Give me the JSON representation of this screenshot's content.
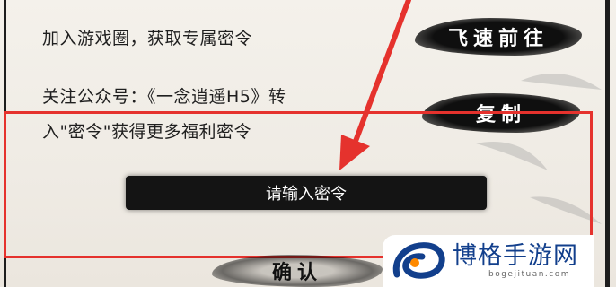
{
  "rows": {
    "join_text": "加入游戏圈，获取专属密令",
    "follow_line1": "关注公众号：《一念逍遥H5》转",
    "follow_line2": "入\"密令\"获得更多福利密令"
  },
  "buttons": {
    "go": "飞速前往",
    "copy": "复制",
    "confirm": "确认"
  },
  "input": {
    "placeholder": "请输入密令"
  },
  "annotation": {
    "box_color": "#e5322d",
    "arrow_color": "#e5322d"
  },
  "watermark": {
    "name": "博格手游网",
    "url": "bogejituan.com"
  }
}
